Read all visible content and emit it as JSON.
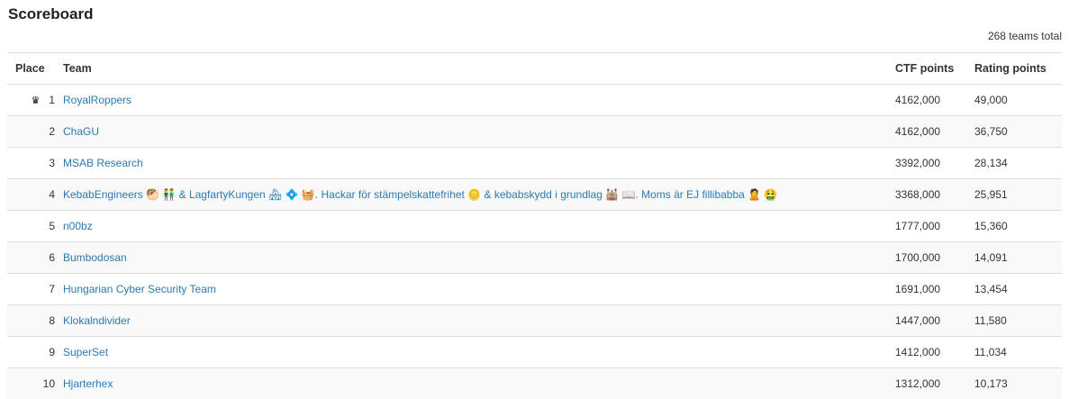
{
  "page": {
    "title": "Scoreboard",
    "total": "268 teams total"
  },
  "table": {
    "headers": {
      "place": "Place",
      "team": "Team",
      "ctf": "CTF points",
      "rating": "Rating points"
    },
    "rows": [
      {
        "place": "1",
        "team": "RoyalRoppers",
        "ctf": "4162,000",
        "rating": "49,000",
        "crown": "♛"
      },
      {
        "place": "2",
        "team": "ChaGU",
        "ctf": "4162,000",
        "rating": "36,750"
      },
      {
        "place": "3",
        "team": "MSAB Research",
        "ctf": "3392,000",
        "rating": "28,134"
      },
      {
        "place": "4",
        "team": "KebabEngineers 🥙 👬 & LagfartyKungen 🏘 💠 🧺. Hackar för stämpelskattefrihet 🪙 & kebabskydd i grundlag 🕍 📖. Moms är EJ fillibabba 🙎 🤮",
        "ctf": "3368,000",
        "rating": "25,951"
      },
      {
        "place": "5",
        "team": "n00bz",
        "ctf": "1777,000",
        "rating": "15,360"
      },
      {
        "place": "6",
        "team": "Bumbodosan",
        "ctf": "1700,000",
        "rating": "14,091"
      },
      {
        "place": "7",
        "team": "Hungarian Cyber Security Team",
        "ctf": "1691,000",
        "rating": "13,454"
      },
      {
        "place": "8",
        "team": "Klokalndivider",
        "ctf": "1447,000",
        "rating": "11,580"
      },
      {
        "place": "9",
        "team": "SuperSet",
        "ctf": "1412,000",
        "rating": "11,034"
      },
      {
        "place": "10",
        "team": "Hjarterhex",
        "ctf": "1312,000",
        "rating": "10,173"
      }
    ]
  }
}
